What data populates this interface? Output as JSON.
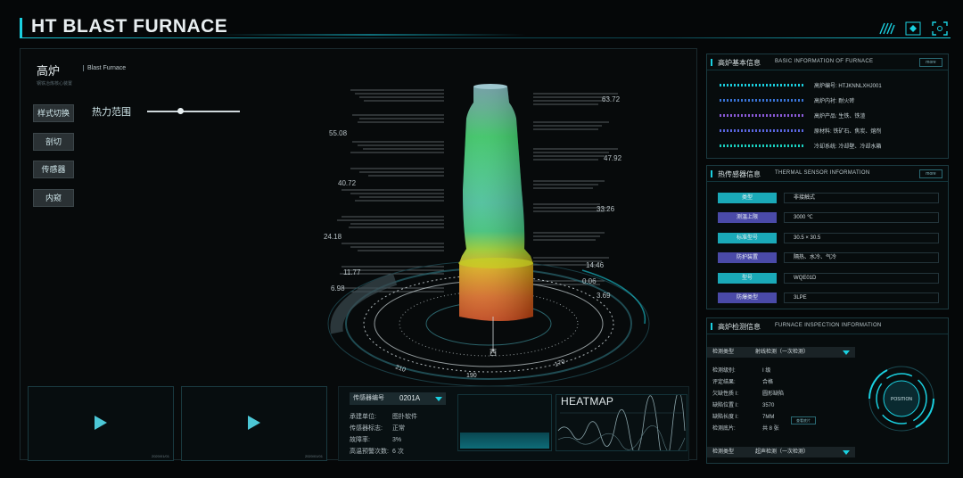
{
  "app": {
    "title": "HT BLAST FURNACE"
  },
  "brand": {
    "cn": "高炉",
    "sub": "钢铁冶炼核心装置",
    "en": "Blast Furnace"
  },
  "side_buttons": [
    "样式切换",
    "剖切",
    "传感器",
    "内窥"
  ],
  "heat_control": {
    "label": "热力范围",
    "level": 0.36
  },
  "scale_right": [
    "63.72",
    "47.92",
    "33.26",
    "14.46",
    "0.06",
    "3.69"
  ],
  "scale_left": [
    "55.08",
    "40.72",
    "24.18",
    "11.77",
    "6.98"
  ],
  "dial_labels": [
    "210",
    "190",
    "170",
    "西"
  ],
  "videos": [
    {
      "stamp": "2020/01/01"
    },
    {
      "stamp": "2020/01/01"
    }
  ],
  "sensor_panel": {
    "select_label": "传感器编号",
    "select_value": "0201A",
    "rows": [
      {
        "k": "承建单位:",
        "v": "图扑软件"
      },
      {
        "k": "传感器标志:",
        "v": "正常"
      },
      {
        "k": "故障率:",
        "v": "3%"
      },
      {
        "k": "高温预警次数:",
        "v": "6 次"
      }
    ]
  },
  "heatmap": {
    "title": "HEATMAP"
  },
  "basic_info": {
    "title_cn": "高炉基本信息",
    "title_en": "BASIC INFORMATION OF FURNACE",
    "more": "more",
    "rows": [
      {
        "text": "高炉编号:  HTJKNNLXHJ001",
        "color": "#1ad0e0"
      },
      {
        "text": "高炉内衬:  耐火砖",
        "color": "#3a74d8"
      },
      {
        "text": "高炉产品:  生铁、铁渣",
        "color": "#8a5ad8"
      },
      {
        "text": "原材料:  铁矿石、焦炭、熔剂",
        "color": "#5a66e0"
      },
      {
        "text": "冷却系统:  冷却壁、冷却水箱",
        "color": "#1ad0c0"
      }
    ]
  },
  "thermal_info": {
    "title_cn": "热传感器信息",
    "title_en": "THERMAL SENSOR INFORMATION",
    "more": "more",
    "rows": [
      {
        "k": "类型",
        "v": "非接触式",
        "color": "#1aa9b8"
      },
      {
        "k": "测温上限",
        "v": "3000 ℃",
        "color": "#4a4aa8"
      },
      {
        "k": "标准型号",
        "v": "30.5 × 30.5",
        "color": "#1aa9b8"
      },
      {
        "k": "防护装置",
        "v": "隔热、水冷、气冷",
        "color": "#4a4aa8"
      },
      {
        "k": "型号",
        "v": "WQE01D",
        "color": "#1aa9b8"
      },
      {
        "k": "防爆类型",
        "v": "3LPE",
        "color": "#4a4aa8"
      }
    ]
  },
  "inspection_info": {
    "title_cn": "高炉检测信息",
    "title_en": "FURNACE INSPECTION INFORMATION",
    "select1": {
      "k": "检测类型",
      "v": "射线检测（一次检测）"
    },
    "rows": [
      {
        "k": "检测级别:",
        "v": "I 级"
      },
      {
        "k": "评定结果:",
        "v": "合格"
      },
      {
        "k": "欠缺性质 I:",
        "v": "圆形缺陷"
      },
      {
        "k": "缺陷位置 I:",
        "v": "3570"
      },
      {
        "k": "缺陷长度 I:",
        "v": "7MM"
      },
      {
        "k": "检测底片:",
        "v": "共 8 张"
      }
    ],
    "view_btn": "查看底片",
    "select2": {
      "k": "检测类型",
      "v": "超声检测（一次检测）"
    },
    "position_label": "POSITION"
  },
  "colors": {
    "accent": "#1ad0e0",
    "bg": "#050708"
  }
}
